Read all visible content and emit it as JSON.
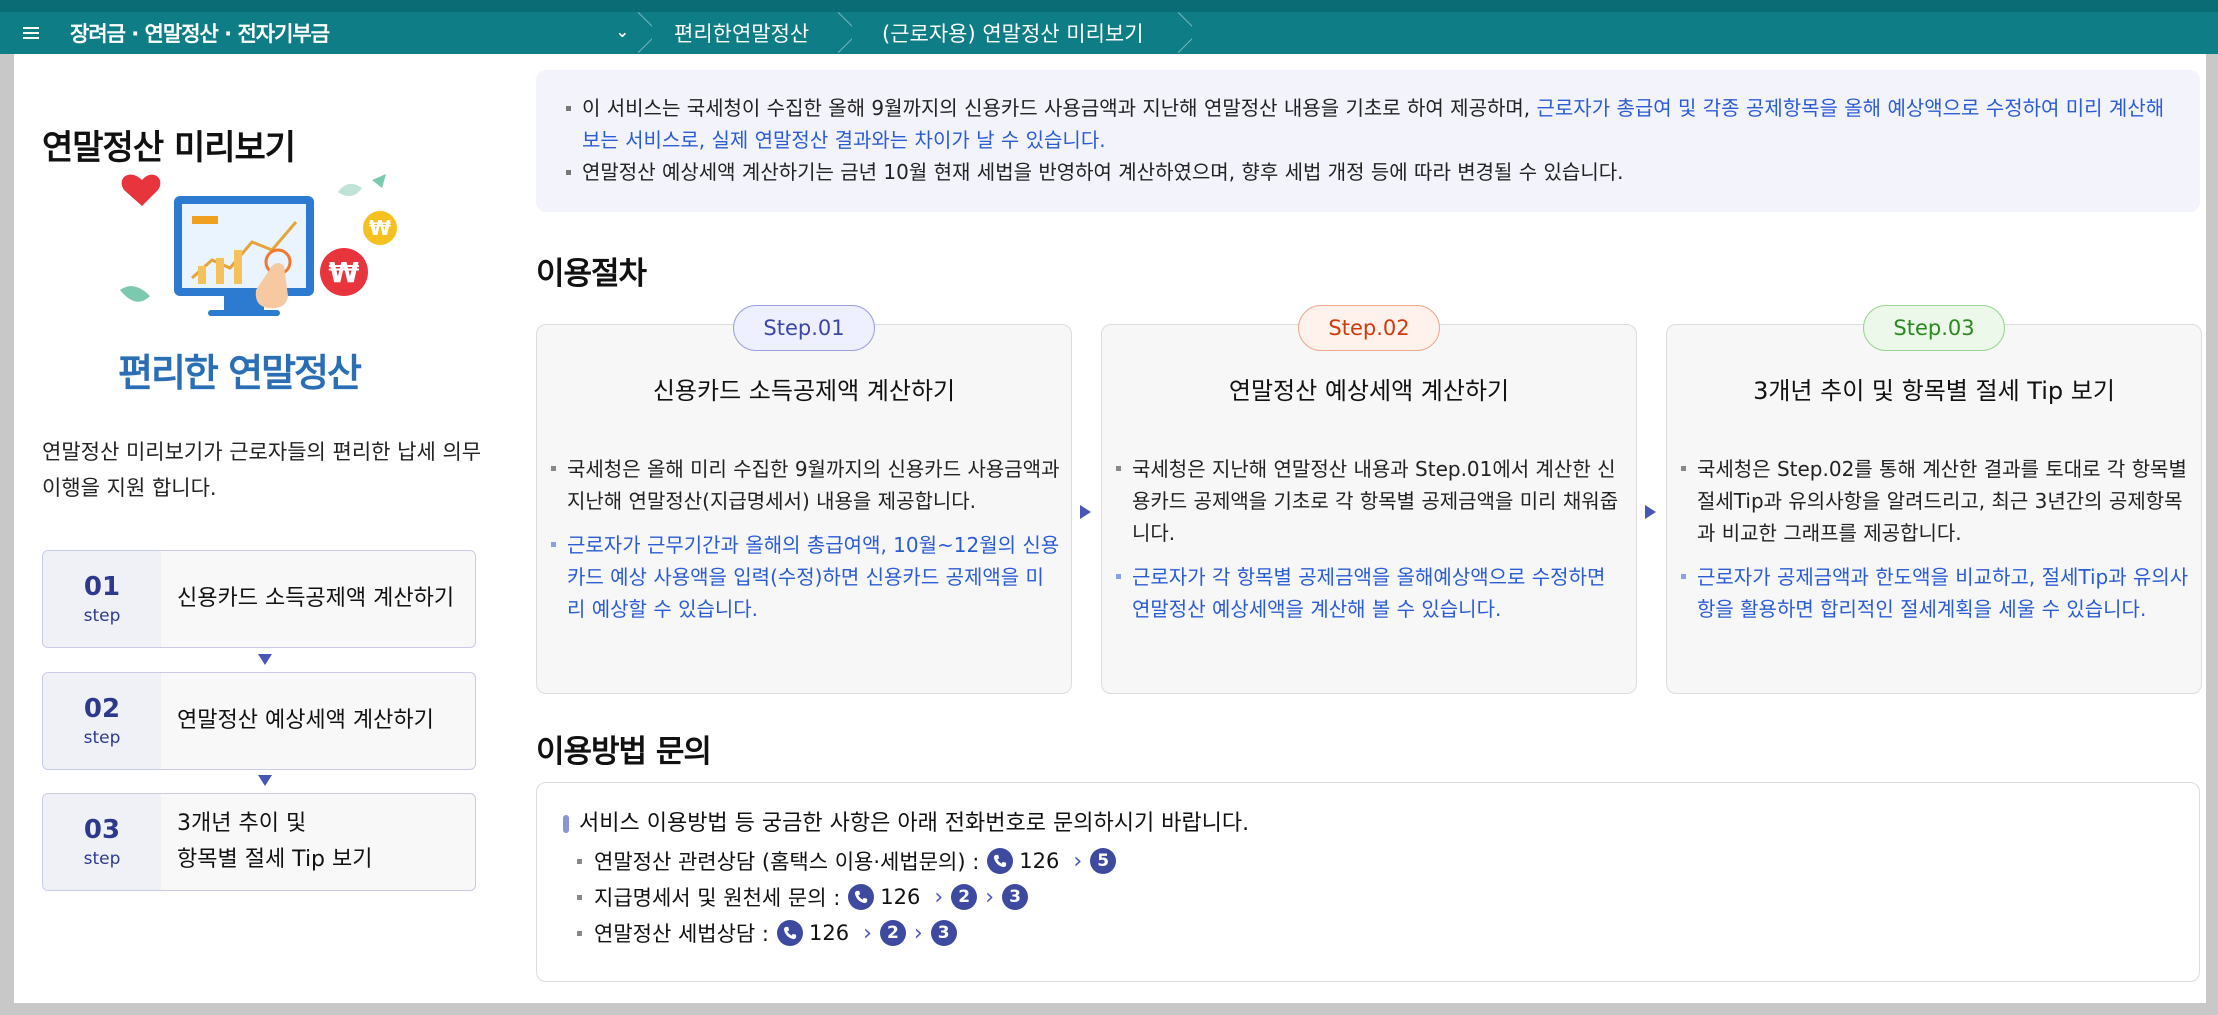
{
  "header": {
    "breadcrumbs": [
      "장려금 · 연말정산 · 전자기부금",
      "편리한연말정산",
      "(근로자용) 연말정산 미리보기"
    ]
  },
  "left": {
    "title": "연말정산 미리보기",
    "hero_caption": "편리한 연말정산",
    "description": "연말정산 미리보기가 근로자들의  편리한 납세 의무 이행을 지원 합니다.",
    "steps": [
      {
        "num": "01",
        "unit": "step",
        "label": "신용카드 소득공제액 계산하기"
      },
      {
        "num": "02",
        "unit": "step",
        "label": "연말정산 예상세액 계산하기"
      },
      {
        "num": "03",
        "unit": "step",
        "label_line1": "3개년 추이 및",
        "label_line2": "항목별 절세 Tip 보기"
      }
    ]
  },
  "notice": {
    "item1_plain": "이 서비스는 국세청이 수집한 올해 9월까지의 신용카드 사용금액과 지난해 연말정산 내용을 기초로 하여 제공하며, ",
    "item1_blue": "근로자가 총급여 및 각종 공제항목을 올해 예상액으로 수정하여 미리 계산해 보는 서비스로, 실제 연말정산 결과와는 차이가 날 수 있습니다.",
    "item2": "연말정산 예상세액 계산하기는 금년 10월 현재 세법을 반영하여 계산하였으며, 향후 세법 개정 등에 따라 변경될 수 있습니다."
  },
  "process": {
    "title": "이용절차",
    "cards": [
      {
        "badge": "Step.01",
        "title": "신용카드 소득공제액 계산하기",
        "text": "국세청은 올해 미리 수집한 9월까지의 신용카드 사용금액과 지난해 연말정산(지급명세서) 내용을 제공합니다.",
        "blue_text": "근로자가 근무기간과 올해의 총급여액, 10월~12월의 신용카드 예상 사용액을 입력(수정)하면 신용카드 공제액을 미리 예상할 수 있습니다."
      },
      {
        "badge": "Step.02",
        "title": "연말정산 예상세액 계산하기",
        "text": "국세청은 지난해 연말정산 내용과 Step.01에서 계산한 신용카드 공제액을 기초로 각 항목별 공제금액을 미리 채워줍니다.",
        "blue_text": "근로자가 각 항목별 공제금액을 올해예상액으로 수정하면 연말정산 예상세액을 계산해 볼 수 있습니다."
      },
      {
        "badge": "Step.03",
        "title": "3개년 추이 및 항목별 절세 Tip 보기",
        "text": "국세청은 Step.02를 통해 계산한 결과를 토대로 각 항목별 절세Tip과 유의사항을 알려드리고, 최근 3년간의 공제항목과 비교한 그래프를 제공합니다.",
        "blue_text": "근로자가 공제금액과 한도액을 비교하고, 절세Tip과 유의사항을 활용하면 합리적인 절세계획을 세울 수 있습니다."
      }
    ]
  },
  "inquiry": {
    "title": "이용방법 문의",
    "main": "서비스 이용방법 등 궁금한 사항은 아래 전화번호로 문의하시기 바랍니다.",
    "rows": [
      {
        "label": "연말정산 관련상담 (홈택스 이용·세법문의) :",
        "phone": "126",
        "codes": [
          "5"
        ]
      },
      {
        "label": "지급명세서 및 원천세 문의 :",
        "phone": "126",
        "codes": [
          "2",
          "3"
        ]
      },
      {
        "label": "연말정산 세법상담 :",
        "phone": "126",
        "codes": [
          "2",
          "3"
        ]
      }
    ]
  },
  "colors": {
    "header_bg": "#0e7d86",
    "accent": "#3d4aa0",
    "blue_text": "#2a5cd6"
  }
}
